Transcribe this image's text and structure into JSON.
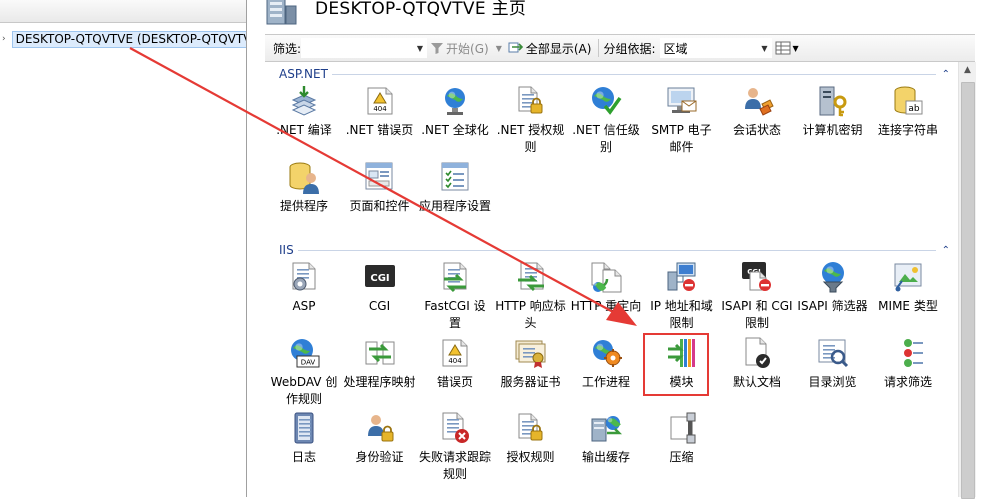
{
  "tree": {
    "server_label": "DESKTOP-QTQVTVE (DESKTOP-QTQVTVE\\Administrator)",
    "expand_glyph": "›"
  },
  "header": {
    "title": "DESKTOP-QTQVTVE 主页"
  },
  "filter_bar": {
    "filter_label": "筛选:",
    "start_button": "开始(G)",
    "show_all_button": "全部显示(A)",
    "group_label": "分组依据:",
    "group_value": "区域"
  },
  "sections": [
    {
      "name": "ASP.NET",
      "items": [
        {
          "label": ".NET 编译",
          "icon": "net-compile-icon"
        },
        {
          "label": ".NET 错误页",
          "icon": "net-error-page-icon"
        },
        {
          "label": ".NET 全球化",
          "icon": "net-globalization-icon"
        },
        {
          "label": ".NET 授权规则",
          "icon": "net-authorization-icon"
        },
        {
          "label": ".NET 信任级别",
          "icon": "net-trust-level-icon"
        },
        {
          "label": "SMTP 电子邮件",
          "icon": "smtp-email-icon"
        },
        {
          "label": "会话状态",
          "icon": "session-state-icon"
        },
        {
          "label": "计算机密钥",
          "icon": "machine-key-icon"
        },
        {
          "label": "连接字符串",
          "icon": "connection-strings-icon"
        },
        {
          "label": "提供程序",
          "icon": "providers-icon"
        },
        {
          "label": "页面和控件",
          "icon": "pages-controls-icon"
        },
        {
          "label": "应用程序设置",
          "icon": "app-settings-icon"
        }
      ]
    },
    {
      "name": "IIS",
      "items": [
        {
          "label": "ASP",
          "icon": "asp-icon"
        },
        {
          "label": "CGI",
          "icon": "cgi-icon"
        },
        {
          "label": "FastCGI 设置",
          "icon": "fastcgi-icon"
        },
        {
          "label": "HTTP 响应标头",
          "icon": "http-response-headers-icon"
        },
        {
          "label": "HTTP 重定向",
          "icon": "http-redirect-icon"
        },
        {
          "label": "IP 地址和域限制",
          "icon": "ip-restrictions-icon"
        },
        {
          "label": "ISAPI 和 CGI 限制",
          "icon": "isapi-cgi-restrictions-icon"
        },
        {
          "label": "ISAPI 筛选器",
          "icon": "isapi-filters-icon"
        },
        {
          "label": "MIME 类型",
          "icon": "mime-types-icon"
        },
        {
          "label": "WebDAV 创作规则",
          "icon": "webdav-icon"
        },
        {
          "label": "处理程序映射",
          "icon": "handler-mappings-icon"
        },
        {
          "label": "错误页",
          "icon": "error-pages-icon"
        },
        {
          "label": "服务器证书",
          "icon": "server-certificates-icon"
        },
        {
          "label": "工作进程",
          "icon": "worker-processes-icon"
        },
        {
          "label": "模块",
          "icon": "modules-icon"
        },
        {
          "label": "默认文档",
          "icon": "default-document-icon"
        },
        {
          "label": "目录浏览",
          "icon": "directory-browsing-icon"
        },
        {
          "label": "请求筛选",
          "icon": "request-filtering-icon"
        },
        {
          "label": "日志",
          "icon": "logging-icon"
        },
        {
          "label": "身份验证",
          "icon": "authentication-icon"
        },
        {
          "label": "失败请求跟踪规则",
          "icon": "failed-request-tracing-icon"
        },
        {
          "label": "授权规则",
          "icon": "authorization-rules-icon"
        },
        {
          "label": "输出缓存",
          "icon": "output-caching-icon"
        },
        {
          "label": "压缩",
          "icon": "compression-icon"
        }
      ]
    }
  ],
  "annotation": {
    "color": "#e53a35",
    "highlighted": "模块"
  },
  "colors": {
    "section_text": "#1e3e8a",
    "tree_selected": "#dcebfc"
  }
}
